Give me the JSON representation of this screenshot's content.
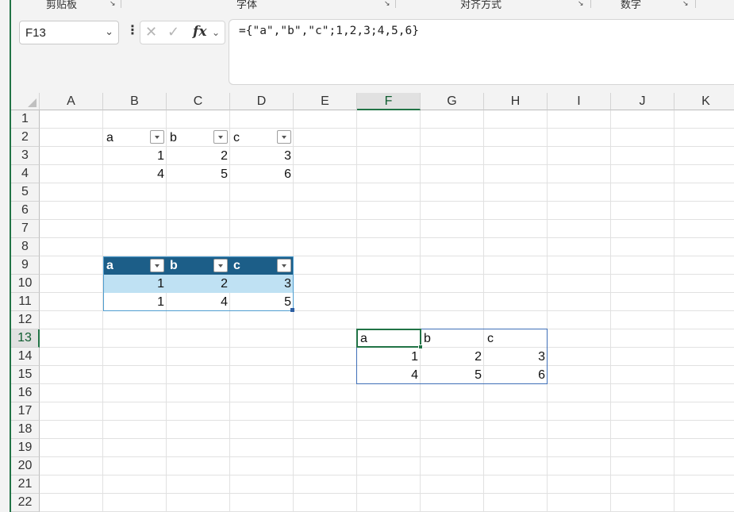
{
  "ribbon": {
    "groups": [
      "剪贴板",
      "字体",
      "对齐方式",
      "数字"
    ]
  },
  "formula_bar": {
    "name_box": "F13",
    "formula": "={\"a\",\"b\",\"c\";1,2,3;4,5,6}",
    "fx_label": "fx"
  },
  "columns": [
    "A",
    "B",
    "C",
    "D",
    "E",
    "F",
    "G",
    "H",
    "I",
    "J",
    "K"
  ],
  "rows": [
    "1",
    "2",
    "3",
    "4",
    "5",
    "6",
    "7",
    "8",
    "9",
    "10",
    "11",
    "12",
    "13",
    "14",
    "15",
    "16",
    "17",
    "18",
    "19",
    "20",
    "21",
    "22"
  ],
  "active_cell": {
    "column": "F",
    "row": "13"
  },
  "table1": {
    "headers": [
      "a",
      "b",
      "c"
    ],
    "rows": [
      [
        "1",
        "2",
        "3"
      ],
      [
        "4",
        "5",
        "6"
      ]
    ]
  },
  "table2": {
    "headers": [
      "a",
      "b",
      "c"
    ],
    "rows": [
      [
        "1",
        "2",
        "3"
      ],
      [
        "1",
        "4",
        "5"
      ]
    ],
    "header_color": "#1c5e88",
    "band_color": "#bfe1f3"
  },
  "spill": {
    "headers": [
      "a",
      "b",
      "c"
    ],
    "rows": [
      [
        "1",
        "2",
        "3"
      ],
      [
        "4",
        "5",
        "6"
      ]
    ]
  },
  "colors": {
    "accent": "#217346",
    "spill_border": "#3f6fb8"
  }
}
